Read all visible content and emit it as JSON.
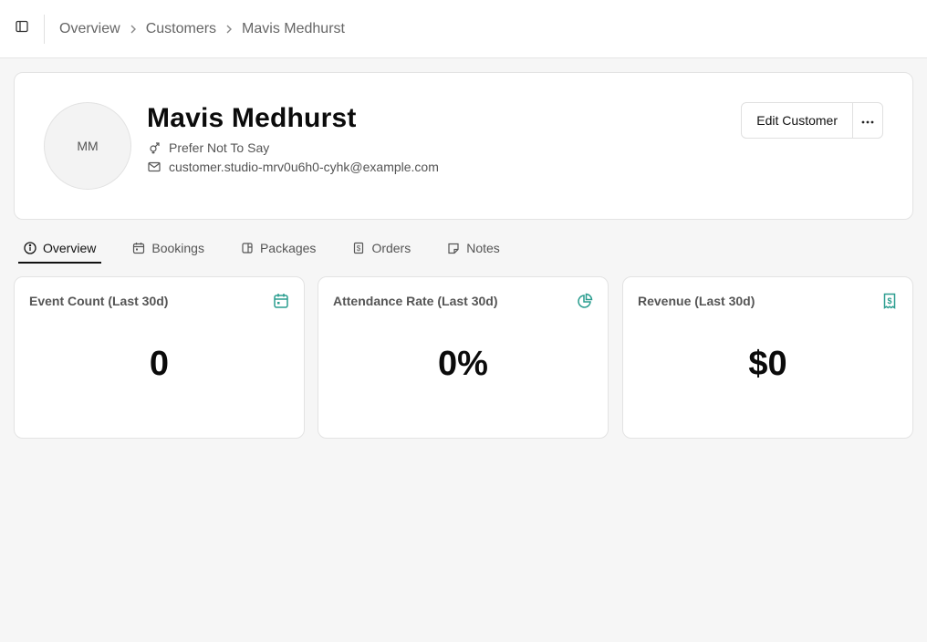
{
  "breadcrumb": {
    "items": [
      "Overview",
      "Customers",
      "Mavis Medhurst"
    ]
  },
  "profile": {
    "initials": "MM",
    "name": "Mavis Medhurst",
    "gender": "Prefer Not To Say",
    "email": "customer.studio-mrv0u6h0-cyhk@example.com",
    "edit_label": "Edit Customer",
    "more_label": "..."
  },
  "tabs": [
    {
      "label": "Overview",
      "icon": "info-icon",
      "active": true
    },
    {
      "label": "Bookings",
      "icon": "calendar-icon",
      "active": false
    },
    {
      "label": "Packages",
      "icon": "package-icon",
      "active": false
    },
    {
      "label": "Orders",
      "icon": "receipt-icon",
      "active": false
    },
    {
      "label": "Notes",
      "icon": "note-icon",
      "active": false
    }
  ],
  "stats": [
    {
      "title": "Event Count (Last 30d)",
      "value": "0",
      "icon": "calendar-icon"
    },
    {
      "title": "Attendance Rate (Last 30d)",
      "value": "0%",
      "icon": "pie-chart-icon"
    },
    {
      "title": "Revenue (Last 30d)",
      "value": "$0",
      "icon": "receipt-icon"
    }
  ],
  "colors": {
    "accent": "#2a9d8f",
    "background": "#f6f6f6",
    "card": "#ffffff"
  }
}
